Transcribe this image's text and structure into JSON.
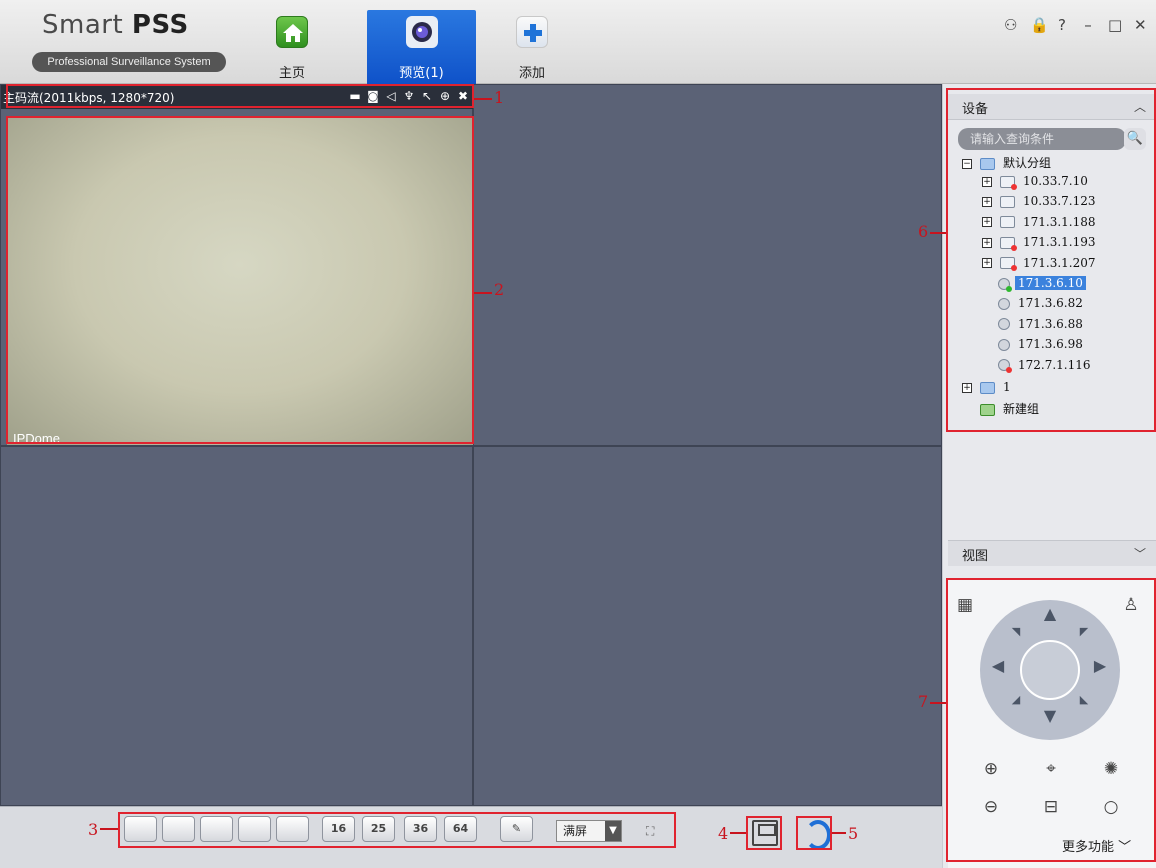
{
  "app": {
    "logo_main": "Smart ",
    "logo_bold": "PSS",
    "logo_sub": "Professional Surveillance System"
  },
  "nav": {
    "home": "主页",
    "preview": "预览(1)",
    "add": "添加"
  },
  "window_controls": [
    "⚇",
    "🔒",
    "?",
    "–",
    "□",
    "✕"
  ],
  "camera": {
    "stream_info": "主码流(2011kbps, 1280*720)",
    "overlay_label": "IPDome",
    "tools": [
      "record",
      "snapshot",
      "mute",
      "talk",
      "cursor",
      "zoom",
      "close"
    ]
  },
  "layout_buttons": [
    "",
    "",
    "",
    "",
    "",
    "16",
    "25",
    "36",
    "64",
    ""
  ],
  "full_mode": "满屏",
  "device_panel": {
    "title": "设备",
    "search_placeholder": "请输入查询条件",
    "group_name": "默认分组",
    "devices": [
      {
        "name": "10.33.7.10",
        "type": "nvr",
        "status": "off",
        "expandable": true
      },
      {
        "name": "10.33.7.123",
        "type": "nvr",
        "status": "on",
        "expandable": true
      },
      {
        "name": "171.3.1.188",
        "type": "nvr",
        "status": "on",
        "expandable": true
      },
      {
        "name": "171.3.1.193",
        "type": "nvr",
        "status": "off",
        "expandable": true
      },
      {
        "name": "171.3.1.207",
        "type": "nvr",
        "status": "off",
        "expandable": true
      },
      {
        "name": "171.3.6.10",
        "type": "cam",
        "status": "on",
        "selected": true
      },
      {
        "name": "171.3.6.82",
        "type": "cam",
        "status": "plain"
      },
      {
        "name": "171.3.6.88",
        "type": "cam",
        "status": "plain"
      },
      {
        "name": "171.3.6.98",
        "type": "cam",
        "status": "plain"
      },
      {
        "name": "172.7.1.116",
        "type": "cam",
        "status": "off"
      }
    ],
    "group2_name": "1",
    "new_group": "新建组"
  },
  "view_panel": {
    "title": "视图"
  },
  "ptz": {
    "more_label": "更多功能"
  },
  "annotations": [
    "1",
    "2",
    "3",
    "4",
    "5",
    "6",
    "7"
  ]
}
